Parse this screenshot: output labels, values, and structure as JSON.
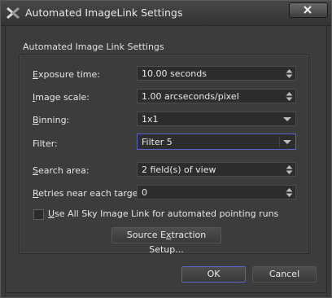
{
  "window": {
    "title": "Automated ImageLink Settings",
    "icon": "x-logo-icon"
  },
  "group": {
    "title": "Automated Image Link Settings"
  },
  "fields": {
    "exposure": {
      "label_u": "E",
      "label_rest": "xposure time:",
      "value": "10.00 seconds",
      "control": "spinbox"
    },
    "scale": {
      "label_u": "I",
      "label_rest": "mage scale:",
      "value": "1.00 arcseconds/pixel",
      "control": "spinbox"
    },
    "binning": {
      "label_u": "B",
      "label_rest": "inning:",
      "value": "1x1",
      "control": "dropdown"
    },
    "filter": {
      "label": "Filter:",
      "value": "Filter 5",
      "control": "dropdown"
    },
    "search": {
      "label_u": "S",
      "label_rest": "earch area:",
      "value": "2 field(s) of view",
      "control": "spinbox"
    },
    "retries": {
      "label_u": "R",
      "label_rest": "etries near each target:",
      "value": "0",
      "control": "spinbox"
    }
  },
  "checkbox": {
    "label_u": "U",
    "label_rest": "se All Sky Image Link for automated pointing runs",
    "checked": false
  },
  "buttons": {
    "source_pre": "Source E",
    "source_u": "x",
    "source_post": "traction Setup...",
    "ok": "OK",
    "cancel": "Cancel"
  },
  "colors": {
    "focus_border": "#5b62c9",
    "background": "#3c3c3c"
  }
}
